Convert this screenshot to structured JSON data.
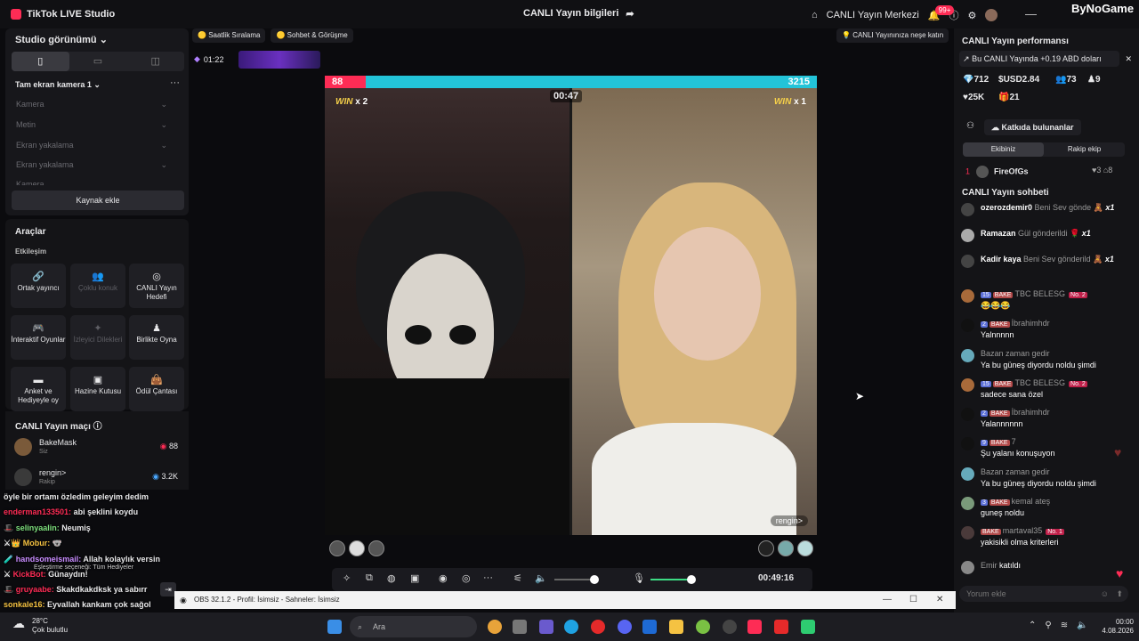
{
  "app": {
    "title": "TikTok LIVE Studio",
    "center_title": "CANLI Yayın bilgileri",
    "live_center": "CANLI Yayın Merkezi",
    "notif_count": "99+",
    "watermark": "ByNoGame"
  },
  "studio": {
    "view_title": "Studio görünümü",
    "camera_title": "Tam ekran kamera 1",
    "sources": [
      "Kamera",
      "Metin",
      "Ekran yakalama",
      "Ekran yakalama",
      "Kamera"
    ],
    "add_source": "Kaynak ekle"
  },
  "tools": {
    "title": "Araçlar",
    "sub": "Etkileşim",
    "items": [
      {
        "label": "Ortak yayıncı",
        "icon": "link-icon"
      },
      {
        "label": "Çoklu konuk",
        "icon": "users-icon"
      },
      {
        "label": "CANLI Yayın Hedefi",
        "icon": "target-icon"
      },
      {
        "label": "İnteraktif Oyunlar",
        "icon": "gamepad-icon"
      },
      {
        "label": "İzleyici Dilekleri",
        "icon": "wish-icon"
      },
      {
        "label": "Birlikte Oyna",
        "icon": "play-together-icon"
      },
      {
        "label": "Anket ve Hediyeyle oy",
        "icon": "poll-icon"
      },
      {
        "label": "Hazine Kutusu",
        "icon": "treasure-icon"
      },
      {
        "label": "Ödül Çantası",
        "icon": "reward-bag-icon"
      }
    ]
  },
  "match": {
    "title": "CANLI Yayın maçı",
    "rows": [
      {
        "name": "BakeMask",
        "sub": "Siz",
        "value": "88"
      },
      {
        "name": "rengin>",
        "sub": "Rakip",
        "value": "3.2K"
      }
    ]
  },
  "overlay_chat": [
    {
      "name": "",
      "text": "öyle bir ortamı özledim geleyim dedim"
    },
    {
      "name": "enderman133501:",
      "text": "abi şeklini koydu"
    },
    {
      "name": "selinyaalin:",
      "text": "Neumiş"
    },
    {
      "name": "Mobur:",
      "text": "🐨"
    },
    {
      "name": "handsomeismail:",
      "text": "Allah kolaylık versin"
    },
    {
      "name": "KickBot:",
      "text": "Günaydın!"
    },
    {
      "name": "gruyaabe:",
      "text": "Skakdkakdksk ya sabırr"
    },
    {
      "name": "sonkale16:",
      "text": "Eyvallah kankam çok sağol"
    }
  ],
  "gift_filter": "Eşleştirme seçeneği: Tüm Hediyeler",
  "pills": {
    "ranking": "Saatlik Sıralama",
    "chat": "Sohbet & Görüşme",
    "fun": "CANLI Yayınınıza neşe katın"
  },
  "mini_timer": "01:22",
  "battle": {
    "score_left": "88",
    "score_right": "3215",
    "win_left": "x 2",
    "win_right": "x 1",
    "win_word": "WIN",
    "timer": "00:47",
    "opponent": "rengin>"
  },
  "controls": {
    "time": "00:49:16"
  },
  "performance": {
    "title": "CANLI Yayın performansı",
    "earning": "Bu CANLI Yayında +0.19 ABD doları",
    "stats": [
      "712",
      "USD2.84",
      "73",
      "9",
      "25K",
      "21"
    ],
    "contrib_btn": "Katkıda bulunanlar",
    "team_tabs": [
      "Ekibiniz",
      "Rakip ekip"
    ],
    "top_rank": "1",
    "top_name": "FireOfGs",
    "top_a": "3",
    "top_b": "8"
  },
  "chat": {
    "title": "CANLI Yayın sohbeti",
    "gifts": [
      {
        "name": "ozerozdemir0",
        "text": "Beni Sev gönde",
        "count": "x1"
      },
      {
        "name": "Ramazan",
        "text": "Gül gönderildi",
        "count": "x1"
      },
      {
        "name": "Kadir kaya",
        "text": "Beni Sev gönderild",
        "count": "x1"
      }
    ],
    "messages": [
      {
        "lv": "15",
        "badge": "BAKE",
        "name": "TBC BELESG",
        "rank": "No. 2",
        "msg": "😂😂😂"
      },
      {
        "lv": "2",
        "badge": "BAKE",
        "name": "İbrahimhdr",
        "rank": "",
        "msg": "Yalnnnnn"
      },
      {
        "lv": "",
        "badge": "",
        "name": "Bazan zaman gedir",
        "rank": "",
        "msg": "Ya bu güneş diyordu noldu şimdi"
      },
      {
        "lv": "15",
        "badge": "BAKE",
        "name": "TBC BELESG",
        "rank": "No. 2",
        "msg": "sadece sana özel"
      },
      {
        "lv": "2",
        "badge": "BAKE",
        "name": "İbrahimhdr",
        "rank": "",
        "msg": "Yalannnnnn"
      },
      {
        "lv": "9",
        "badge": "BAKE",
        "name": "7",
        "rank": "",
        "msg": "Şu yalanı konuşuyon"
      },
      {
        "lv": "",
        "badge": "",
        "name": "Bazan zaman gedir",
        "rank": "",
        "msg": "Ya bu güneş diyordu noldu şimdi"
      },
      {
        "lv": "3",
        "badge": "BAKE",
        "name": "kemal ateş",
        "rank": "",
        "msg": "guneş noldu"
      },
      {
        "lv": "",
        "badge": "BAKE",
        "name": "martaval35",
        "rank": "No. 1",
        "msg": "yakisikli olma kriterleri"
      },
      {
        "lv": "",
        "badge": "",
        "name": "Emir",
        "rank": "",
        "msg": "katıldı"
      }
    ],
    "comment_placeholder": "Yorum ekle"
  },
  "obs": {
    "title": "OBS 32.1.2 - Profil: İsimsiz - Sahneler: İsimsiz"
  },
  "taskbar": {
    "temp": "28°C",
    "weather": "Çok bulutlu",
    "search": "Ara",
    "time": "00:00",
    "date": "4.08.2026"
  }
}
